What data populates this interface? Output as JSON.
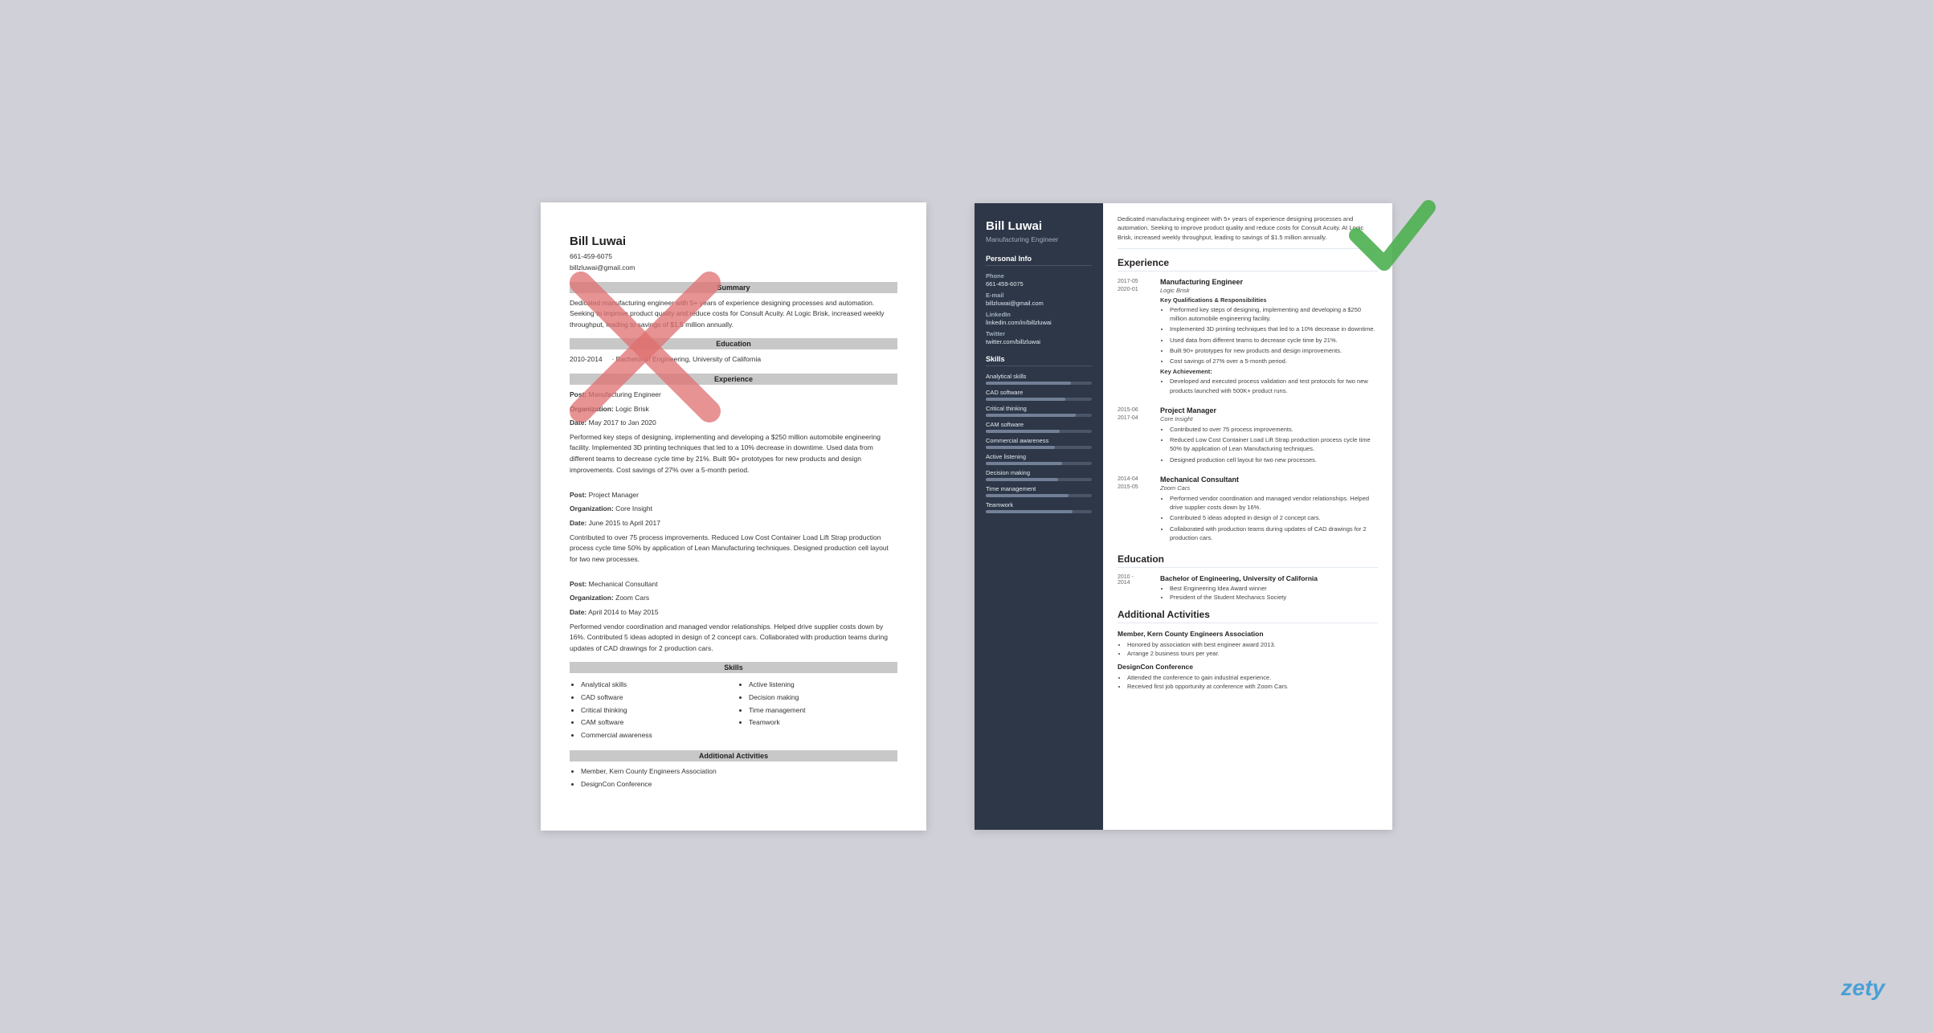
{
  "left_resume": {
    "name": "Bill Luwai",
    "phone": "661-459-6075",
    "email": "billzluwai@gmail.com",
    "sections": {
      "summary": {
        "header": "Summary",
        "text": "Dedicated manufacturing engineer with 5+ years of experience designing processes and automation. Seeking to improve product quality and reduce costs for Consult Acuity. At Logic Brisk, increased weekly throughput, leading to savings of $1.5 million annually."
      },
      "education": {
        "header": "Education",
        "entries": [
          {
            "dates": "2010-2014",
            "degree": "Bachelor of Engineering, University of California"
          }
        ]
      },
      "experience": {
        "header": "Experience",
        "entries": [
          {
            "post_label": "Post:",
            "post": "Manufacturing Engineer",
            "org_label": "Organization:",
            "org": "Logic Brisk",
            "date_label": "Date:",
            "dates": "May 2017 to Jan 2020",
            "desc": "Performed key steps of designing, implementing and developing a $250 million automobile engineering facility. Implemented 3D printing techniques that led to a 10% decrease in downtime. Used data from different teams to decrease cycle time by 21%. Built 90+ prototypes for new products and design improvements. Cost savings of 27% over a 5-month period."
          },
          {
            "post_label": "Post:",
            "post": "Project Manager",
            "org_label": "Organization:",
            "org": "Core Insight",
            "date_label": "Date:",
            "dates": "June 2015 to April 2017",
            "desc": "Contributed to over 75 process improvements. Reduced Low Cost Container Load Lift Strap production process cycle time 50% by application of Lean Manufacturing techniques. Designed production cell layout for two new processes."
          },
          {
            "post_label": "Post:",
            "post": "Mechanical Consultant",
            "org_label": "Organization:",
            "org": "Zoom Cars",
            "date_label": "Date:",
            "dates": "April 2014 to May 2015",
            "desc": "Performed vendor coordination and managed vendor relationships. Helped drive supplier costs down by 16%. Contributed 5 ideas adopted in design of 2 concept cars. Collaborated with production teams during updates of CAD drawings for 2 production cars."
          }
        ]
      },
      "skills": {
        "header": "Skills",
        "col1": [
          "Analytical skills",
          "CAD software",
          "Critical thinking",
          "CAM software",
          "Commercial awareness"
        ],
        "col2": [
          "Active listening",
          "Decision making",
          "Time management",
          "Teamwork"
        ]
      },
      "additional": {
        "header": "Additional Activities",
        "items": [
          "Member, Kern County Engineers Association",
          "DesignCon Conference"
        ]
      }
    }
  },
  "right_resume": {
    "sidebar": {
      "name": "Bill Luwai",
      "title": "Manufacturing Engineer",
      "personal_info_header": "Personal Info",
      "phone_label": "Phone",
      "phone": "661-459-6075",
      "email_label": "E-mail",
      "email": "billzluwai@gmail.com",
      "linkedin_label": "LinkedIn",
      "linkedin": "linkedin.com/in/billzluwai",
      "twitter_label": "Twitter",
      "twitter": "twitter.com/billzluwai",
      "skills_header": "Skills",
      "skills": [
        {
          "name": "Analytical skills",
          "pct": 80
        },
        {
          "name": "CAD software",
          "pct": 75
        },
        {
          "name": "Critical thinking",
          "pct": 85
        },
        {
          "name": "CAM software",
          "pct": 70
        },
        {
          "name": "Commercial awareness",
          "pct": 65
        },
        {
          "name": "Active listening",
          "pct": 72
        },
        {
          "name": "Decision making",
          "pct": 68
        },
        {
          "name": "Time management",
          "pct": 78
        },
        {
          "name": "Teamwork",
          "pct": 82
        }
      ]
    },
    "main": {
      "summary": "Dedicated manufacturing engineer with 5+ years of experience designing processes and automation. Seeking to improve product quality and reduce costs for Consult Acuity. At Logic Brisk, increased weekly throughput, leading to savings of $1.5 million annually.",
      "experience_header": "Experience",
      "experience": [
        {
          "date_start": "2017-05",
          "date_end": "2020-01",
          "title": "Manufacturing Engineer",
          "company": "Logic Brisk",
          "qualifications_header": "Key Qualifications & Responsibilities",
          "bullets": [
            "Performed key steps of designing, implementing and developing a $250 million automobile engineering facility.",
            "Implemented 3D printing techniques that led to a 10% decrease in downtime.",
            "Used data from different teams to decrease cycle time by 21%.",
            "Built 90+ prototypes for new products and design improvements.",
            "Cost savings of 27% over a 5-month period."
          ],
          "achievement_header": "Key Achievement:",
          "achievements": [
            "Developed and executed process validation and test protocols for two new products launched with 500K+ product runs."
          ]
        },
        {
          "date_start": "2015-06",
          "date_end": "2017-04",
          "title": "Project Manager",
          "company": "Core Insight",
          "bullets": [
            "Contributed to over 75 process improvements.",
            "Reduced Low Cost Container Load Lift Strap production process cycle time 50% by application of Lean Manufacturing techniques.",
            "Designed production cell layout for two new processes."
          ]
        },
        {
          "date_start": "2014-04",
          "date_end": "2015-05",
          "title": "Mechanical Consultant",
          "company": "Zoom Cars",
          "bullets": [
            "Performed vendor coordination and managed vendor relationships. Helped drive supplier costs down by 16%.",
            "Contributed 5 ideas adopted in design of 2 concept cars.",
            "Collaborated with production teams during updates of CAD drawings for 2 production cars."
          ]
        }
      ],
      "education_header": "Education",
      "education": [
        {
          "date_start": "2010 -",
          "date_end": "2014",
          "degree": "Bachelor of Engineering, University of California",
          "bullets": [
            "Best Engineering Idea Award winner",
            "President of the Student Mechanics Society"
          ]
        }
      ],
      "additional_header": "Additional Activities",
      "additional": [
        {
          "title": "Member, Kern County Engineers Association",
          "bullets": [
            "Honored by association with best engineer award 2013.",
            "Arrange 2 business tours per year."
          ]
        },
        {
          "title": "DesignCon Conference",
          "bullets": [
            "Attended the conference to gain industrial experience.",
            "Received first job opportunity at conference with Zoom Cars."
          ]
        }
      ]
    }
  },
  "watermark": "zety"
}
